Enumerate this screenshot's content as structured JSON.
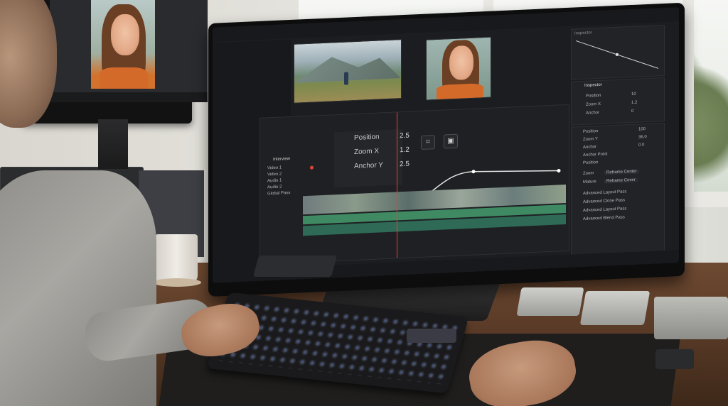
{
  "scene": {
    "description_free": true
  },
  "editor": {
    "viewer_params": [
      {
        "label": "Position",
        "value": "2.5"
      },
      {
        "label": "Zoom X",
        "value": "1.2"
      },
      {
        "label": "Anchor Y",
        "value": "2.5"
      }
    ],
    "inspector": {
      "title": "Inspector",
      "header": "Inspector",
      "rows": [
        {
          "label": "Position",
          "value": "10"
        },
        {
          "label": "Zoom X",
          "value": "1.2"
        },
        {
          "label": "Anchor",
          "value": "0"
        }
      ]
    },
    "side_panel": {
      "rows": [
        {
          "label": "Position",
          "value": "100"
        },
        {
          "label": "Zoom Y",
          "value": "36.0"
        },
        {
          "label": "Anchor",
          "value": "0.0"
        },
        {
          "label": "Anchor Point",
          "value": ""
        },
        {
          "label": "Position",
          "value": ""
        }
      ],
      "dropdowns": [
        {
          "label": "Zoom",
          "value": "Reframe Center"
        },
        {
          "label": "Mature",
          "value": "Reframe Cover"
        }
      ],
      "sections": [
        "Advanced Layout Pass",
        "Advanced Clone Pass",
        "Advanced Layout Pass",
        "Advanced Blend Pass"
      ]
    },
    "tree_title": "Interview",
    "tree_items": [
      "Video 1",
      "Video 2",
      "Audio 1",
      "Audio 2",
      "Global Pass"
    ]
  },
  "colors": {
    "accent_red": "#e0443a",
    "track_green": "#3f8a63",
    "ui_bg": "#1c1d20"
  }
}
